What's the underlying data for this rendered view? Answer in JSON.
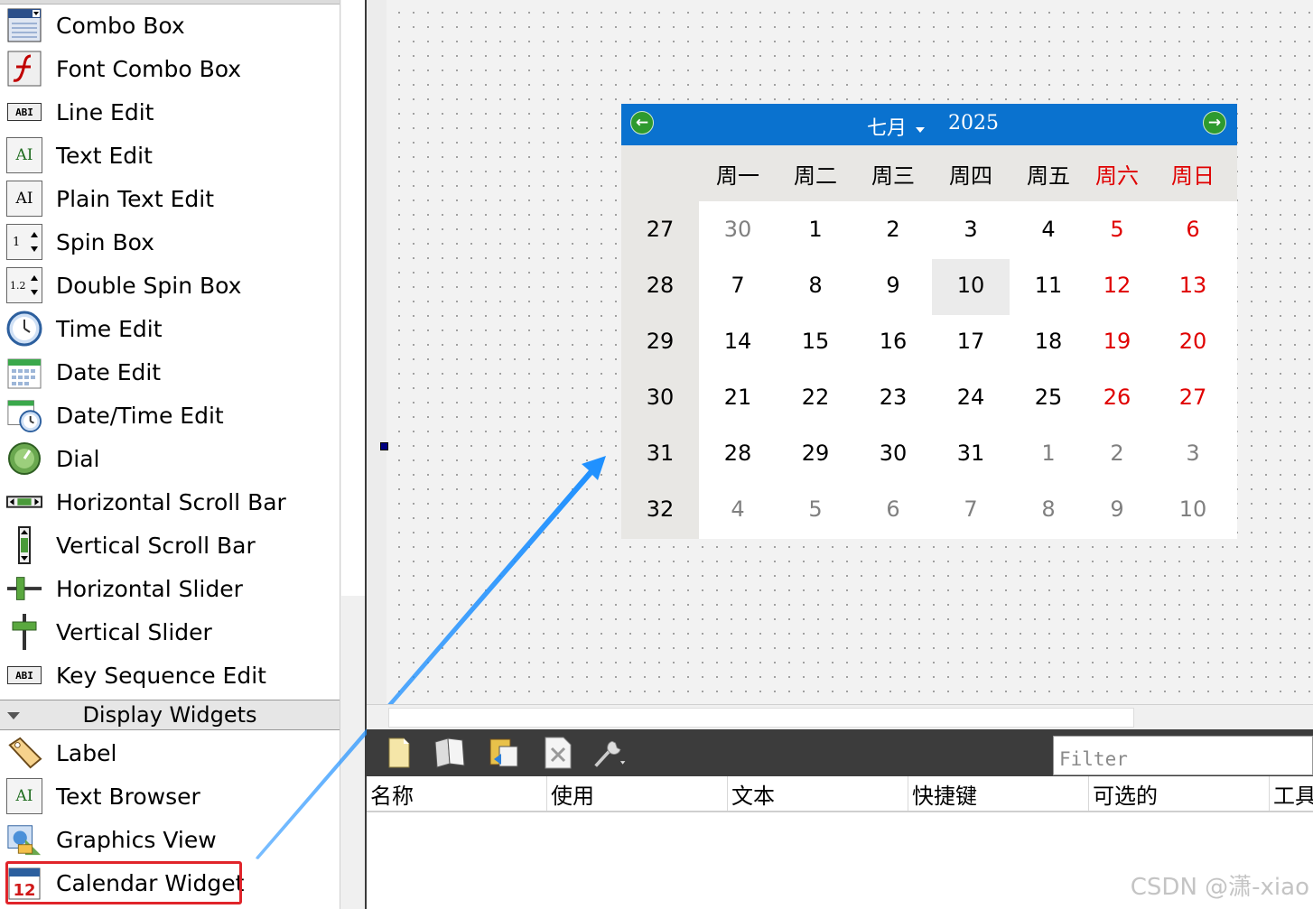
{
  "widget_box": {
    "items": [
      {
        "label": "Combo Box",
        "icon": "combo-box-icon"
      },
      {
        "label": "Font Combo Box",
        "icon": "font-combo-box-icon"
      },
      {
        "label": "Line Edit",
        "icon": "line-edit-icon"
      },
      {
        "label": "Text Edit",
        "icon": "text-edit-icon"
      },
      {
        "label": "Plain Text Edit",
        "icon": "plain-text-edit-icon"
      },
      {
        "label": "Spin Box",
        "icon": "spin-box-icon"
      },
      {
        "label": "Double Spin Box",
        "icon": "double-spin-box-icon"
      },
      {
        "label": "Time Edit",
        "icon": "clock-icon"
      },
      {
        "label": "Date Edit",
        "icon": "calendar-grid-icon"
      },
      {
        "label": "Date/Time Edit",
        "icon": "date-time-icon"
      },
      {
        "label": "Dial",
        "icon": "dial-icon"
      },
      {
        "label": "Horizontal Scroll Bar",
        "icon": "horizontal-scroll-bar-icon"
      },
      {
        "label": "Vertical Scroll Bar",
        "icon": "vertical-scroll-bar-icon"
      },
      {
        "label": "Horizontal Slider",
        "icon": "horizontal-slider-icon"
      },
      {
        "label": "Vertical Slider",
        "icon": "vertical-slider-icon"
      },
      {
        "label": "Key Sequence Edit",
        "icon": "key-sequence-edit-icon"
      }
    ],
    "section_title": "Display Widgets",
    "display_items": [
      {
        "label": "Label",
        "icon": "label-tag-icon"
      },
      {
        "label": "Text Browser",
        "icon": "text-browser-icon"
      },
      {
        "label": "Graphics View",
        "icon": "graphics-view-icon"
      },
      {
        "label": "Calendar Widget",
        "icon": "calendar-widget-icon"
      }
    ],
    "icon_text": {
      "line_edit": "ABI",
      "text_edit": "AI",
      "spin": "1",
      "double_spin": "1.2",
      "calendar_day": "12"
    }
  },
  "calendar": {
    "month": "七月",
    "year": "2025",
    "weekdays": [
      "周一",
      "周二",
      "周三",
      "周四",
      "周五",
      "周六",
      "周日"
    ],
    "weeks": [
      {
        "num": "27",
        "days": [
          "30",
          "1",
          "2",
          "3",
          "4",
          "5",
          "6"
        ]
      },
      {
        "num": "28",
        "days": [
          "7",
          "8",
          "9",
          "10",
          "11",
          "12",
          "13"
        ]
      },
      {
        "num": "29",
        "days": [
          "14",
          "15",
          "16",
          "17",
          "18",
          "19",
          "20"
        ]
      },
      {
        "num": "30",
        "days": [
          "21",
          "22",
          "23",
          "24",
          "25",
          "26",
          "27"
        ]
      },
      {
        "num": "31",
        "days": [
          "28",
          "29",
          "30",
          "31",
          "1",
          "2",
          "3"
        ]
      },
      {
        "num": "32",
        "days": [
          "4",
          "5",
          "6",
          "7",
          "8",
          "9",
          "10"
        ]
      }
    ],
    "selected_day": "10",
    "colors": {
      "header": "#0a72cf",
      "weekend": "#e00000",
      "muted": "#808080"
    }
  },
  "action_editor": {
    "filter_placeholder": "Filter",
    "columns": [
      "名称",
      "使用",
      "文本",
      "快捷键",
      "可选的",
      "工具"
    ],
    "toolbar": [
      "new-action-icon",
      "copy-action-icon",
      "paste-action-icon",
      "delete-action-icon",
      "configure-wrench-icon"
    ]
  },
  "watermark": "CSDN @潇-xiao",
  "annotation_color": "#1e90ff"
}
